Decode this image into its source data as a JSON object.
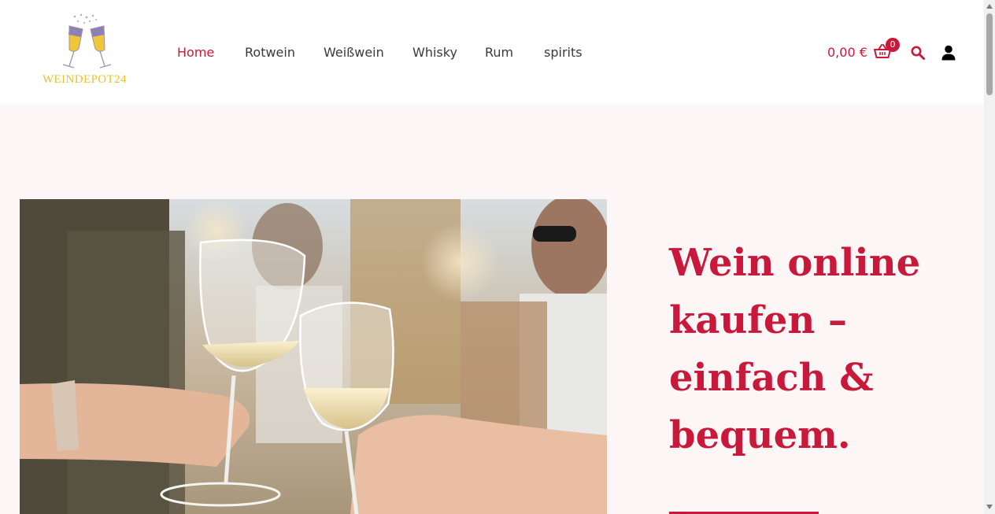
{
  "logo": {
    "text": "WEINDEPOT24"
  },
  "nav": {
    "items": [
      {
        "label": "Home",
        "active": true
      },
      {
        "label": "Rotwein",
        "active": false
      },
      {
        "label": "Weißwein",
        "active": false
      },
      {
        "label": "Whisky",
        "active": false
      },
      {
        "label": "Rum",
        "active": false
      },
      {
        "label": "spirits",
        "active": false
      }
    ]
  },
  "cart": {
    "total": "0,00 €",
    "count": "0"
  },
  "hero": {
    "title": "Wein online kaufen – einfach & bequem."
  },
  "colors": {
    "accent": "#c8193b",
    "hero_bg": "#fdf6f6",
    "logo_gold": "#e8c12c"
  },
  "icons": [
    "cart-icon",
    "search-icon",
    "user-icon"
  ]
}
